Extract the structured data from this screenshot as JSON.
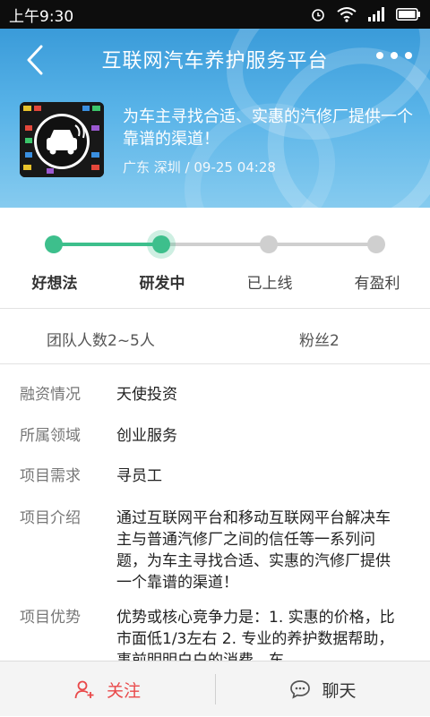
{
  "status_bar": {
    "time": "上午9:30"
  },
  "header": {
    "title": "互联网汽车养护服务平台",
    "tagline": "为车主寻找合适、实惠的汽修厂提供一个靠谱的渠道！",
    "location_date": "广东 深圳 / 09-25  04:28"
  },
  "progress": {
    "stages": [
      "好想法",
      "研发中",
      "已上线",
      "有盈利"
    ],
    "current_index": 1,
    "active_color": "#3dbf8c",
    "inactive_color": "#cfcfcf"
  },
  "stats": {
    "team_size": "团队人数2~5人",
    "fans": "粉丝2"
  },
  "details": {
    "financing_label": "融资情况",
    "financing_value": "天使投资",
    "domain_label": "所属领域",
    "domain_value": "创业服务",
    "needs_label": "项目需求",
    "needs_value": "寻员工",
    "intro_label": "项目介绍",
    "intro_value": "通过互联网平台和移动互联网平台解决车主与普通汽修厂之间的信任等一系列问题，为车主寻找合适、实惠的汽修厂提供一个靠谱的渠道！",
    "advantage_label": "项目优势",
    "advantage_value": "优势或核心竞争力是：1. 实惠的价格，比市面低1/3左右 2. 专业的养护数据帮助，事前明明白白的消费，车"
  },
  "bottom_bar": {
    "follow_label": "关注",
    "chat_label": "聊天",
    "follow_color": "#e9494a"
  }
}
